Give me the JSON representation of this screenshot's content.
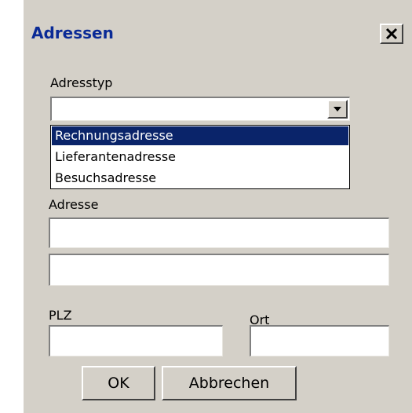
{
  "dialog": {
    "title": "Adressen",
    "close_icon": "close-icon"
  },
  "address_type": {
    "label": "Adresstyp",
    "value": "",
    "options": [
      "Rechnungsadresse",
      "Lieferantenadresse",
      "Besuchsadresse"
    ],
    "highlighted_option": "Rechnungsadresse"
  },
  "address": {
    "label": "Adresse",
    "line1": "",
    "line2": ""
  },
  "postal_code": {
    "label": "PLZ",
    "value": ""
  },
  "city": {
    "label": "Ort",
    "value": ""
  },
  "buttons": {
    "ok": "OK",
    "cancel": "Abbrechen"
  },
  "colors": {
    "title_text": "#0a2a96",
    "highlight": "#0a246a",
    "window_bg": "#d4d0c8"
  }
}
